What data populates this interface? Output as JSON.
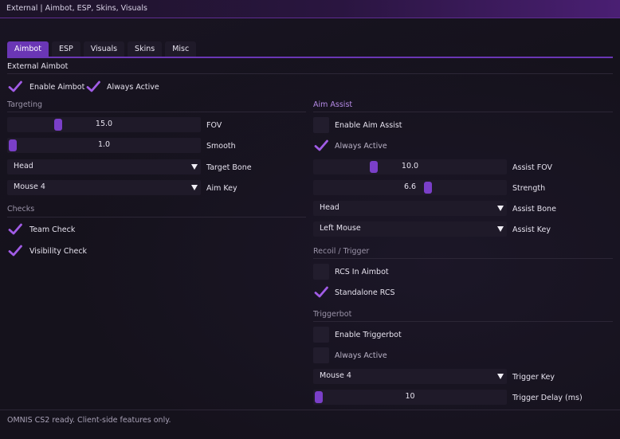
{
  "window": {
    "title": "External | Aimbot, ESP, Skins, Visuals"
  },
  "tabs": [
    {
      "label": "Aimbot"
    },
    {
      "label": "ESP"
    },
    {
      "label": "Visuals"
    },
    {
      "label": "Skins"
    },
    {
      "label": "Misc"
    }
  ],
  "section": {
    "title": "External Aimbot"
  },
  "top_checks": {
    "enable_aimbot": {
      "label": "Enable Aimbot",
      "checked": true
    },
    "always_active": {
      "label": "Always Active",
      "checked": true
    }
  },
  "targeting": {
    "header": "Targeting",
    "fov": {
      "label": "FOV",
      "value": "15.0",
      "fraction": 0.25
    },
    "smooth": {
      "label": "Smooth",
      "value": "1.0",
      "fraction": 0.0
    },
    "target_bone": {
      "label": "Target Bone",
      "value": "Head"
    },
    "aim_key": {
      "label": "Aim Key",
      "value": "Mouse 4"
    }
  },
  "checks": {
    "header": "Checks",
    "team_check": {
      "label": "Team Check",
      "checked": true
    },
    "visibility_check": {
      "label": "Visibility Check",
      "checked": true
    }
  },
  "aim_assist": {
    "header": "Aim Assist",
    "enable": {
      "label": "Enable Aim Assist",
      "checked": false
    },
    "always_active": {
      "label": "Always Active",
      "checked": true
    },
    "fov": {
      "label": "Assist FOV",
      "value": "10.0",
      "fraction": 0.3
    },
    "strength": {
      "label": "Strength",
      "value": "6.6",
      "fraction": 0.6
    },
    "bone": {
      "label": "Assist Bone",
      "value": "Head"
    },
    "key": {
      "label": "Assist Key",
      "value": "Left Mouse"
    }
  },
  "recoil": {
    "header": "Recoil / Trigger",
    "rcs_in_aimbot": {
      "label": "RCS In Aimbot",
      "checked": false
    },
    "standalone_rcs": {
      "label": "Standalone RCS",
      "checked": true
    }
  },
  "triggerbot": {
    "header": "Triggerbot",
    "enable": {
      "label": "Enable Triggerbot",
      "checked": false
    },
    "always_active": {
      "label": "Always Active",
      "checked": false
    },
    "key": {
      "label": "Trigger Key",
      "value": "Mouse 4"
    },
    "delay": {
      "label": "Trigger Delay (ms)",
      "value": "10",
      "fraction": 0.0
    }
  },
  "status": {
    "text": "OMNIS CS2 ready. Client-side features only."
  },
  "colors": {
    "accent": "#6a36b5",
    "check": "#a15ce6",
    "panel": "#1f1a29"
  }
}
